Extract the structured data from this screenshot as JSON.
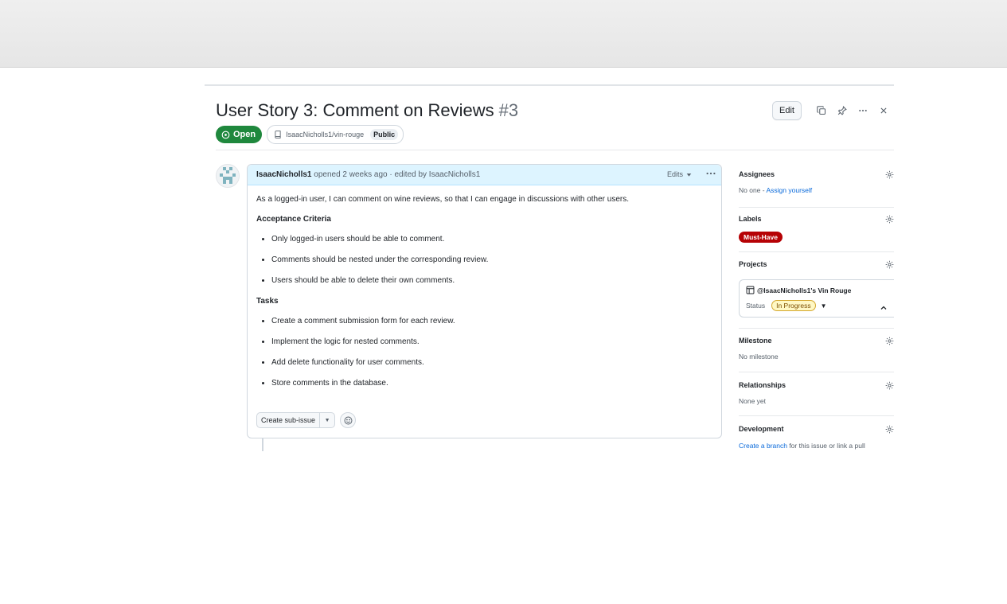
{
  "issue": {
    "title": "User Story 3: Comment on Reviews",
    "number": "#3",
    "state": "Open",
    "repo": "IsaacNicholls1/vin-rouge",
    "visibility": "Public",
    "actions": {
      "edit_label": "Edit"
    }
  },
  "comment": {
    "author": "IsaacNicholls1",
    "meta": "opened 2 weeks ago · edited by IsaacNicholls1",
    "edits_label": "Edits",
    "intro": "As a logged-in user, I can comment on wine reviews, so that I can engage in discussions with other users.",
    "acceptance_heading": "Acceptance Criteria",
    "acceptance_items": [
      "Only logged-in users should be able to comment.",
      "Comments should be nested under the corresponding review.",
      "Users should be able to delete their own comments."
    ],
    "tasks_heading": "Tasks",
    "task_items": [
      "Create a comment submission form for each review.",
      "Implement the logic for nested comments.",
      "Add delete functionality for user comments.",
      "Store comments in the database."
    ],
    "create_subissue_label": "Create sub-issue"
  },
  "sidebar": {
    "assignees": {
      "title": "Assignees",
      "value": "No one - ",
      "link": "Assign yourself"
    },
    "labels": {
      "title": "Labels",
      "label": "Must-Have",
      "label_color": "#b60205"
    },
    "projects": {
      "title": "Projects",
      "project_name": "@IsaacNicholls1's Vin Rouge",
      "status_label": "Status",
      "status_value": "In Progress"
    },
    "milestone": {
      "title": "Milestone",
      "value": "No milestone"
    },
    "relationships": {
      "title": "Relationships",
      "value": "None yet"
    },
    "development": {
      "title": "Development",
      "link": "Create a branch",
      "value": " for this issue or link a pull request."
    }
  },
  "colors": {
    "open_green": "#1f883d",
    "link_blue": "#0969da",
    "header_blue": "#ddf4ff"
  }
}
